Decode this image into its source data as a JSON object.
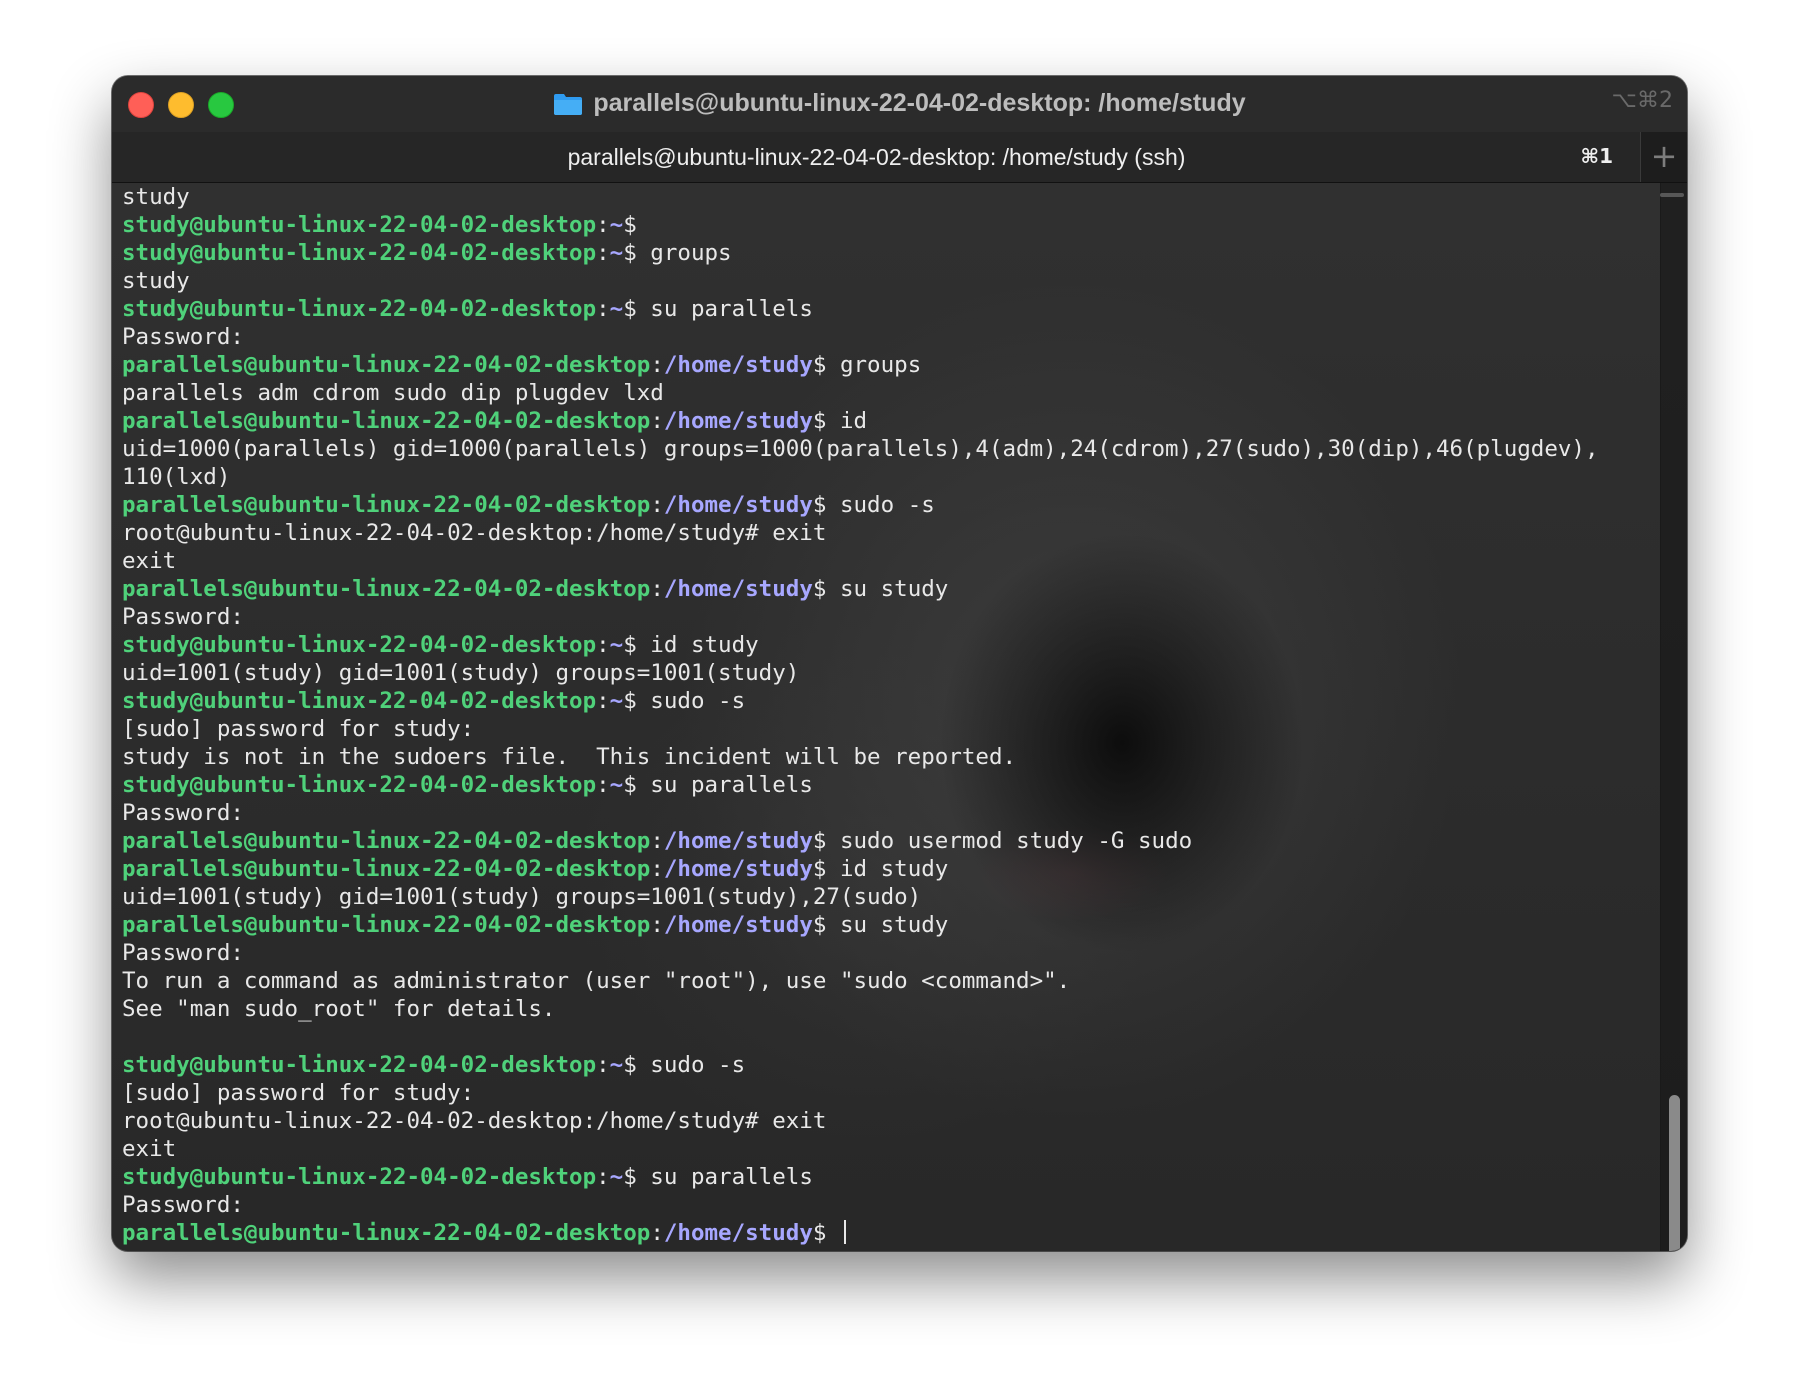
{
  "window": {
    "title": "parallels@ubuntu-linux-22-04-02-desktop: /home/study",
    "title_shortcut": "⌥⌘2",
    "folder_icon": "folder-icon"
  },
  "tab": {
    "label": "parallels@ubuntu-linux-22-04-02-desktop: /home/study (ssh)",
    "shortcut": "⌘1",
    "new_tab_label": "+"
  },
  "colors": {
    "prompt_user": "#4fd17a",
    "prompt_path": "#a7a7ff",
    "text": "#e8e8e8",
    "background": "#2c2c2c"
  },
  "terminal": {
    "lines": [
      {
        "text": "study"
      },
      {
        "user": "study@ubuntu-linux-22-04-02-desktop",
        "path": "~",
        "cmd": "$"
      },
      {
        "user": "study@ubuntu-linux-22-04-02-desktop",
        "path": "~",
        "cmd": "$ groups"
      },
      {
        "text": "study"
      },
      {
        "user": "study@ubuntu-linux-22-04-02-desktop",
        "path": "~",
        "cmd": "$ su parallels"
      },
      {
        "text": "Password:"
      },
      {
        "user": "parallels@ubuntu-linux-22-04-02-desktop",
        "path": "/home/study",
        "cmd": "$ groups"
      },
      {
        "text": "parallels adm cdrom sudo dip plugdev lxd"
      },
      {
        "user": "parallels@ubuntu-linux-22-04-02-desktop",
        "path": "/home/study",
        "cmd": "$ id"
      },
      {
        "text": "uid=1000(parallels) gid=1000(parallels) groups=1000(parallels),4(adm),24(cdrom),27(sudo),30(dip),46(plugdev),"
      },
      {
        "text": "110(lxd)"
      },
      {
        "user": "parallels@ubuntu-linux-22-04-02-desktop",
        "path": "/home/study",
        "cmd": "$ sudo -s"
      },
      {
        "text": "root@ubuntu-linux-22-04-02-desktop:/home/study# exit"
      },
      {
        "text": "exit"
      },
      {
        "user": "parallels@ubuntu-linux-22-04-02-desktop",
        "path": "/home/study",
        "cmd": "$ su study"
      },
      {
        "text": "Password:"
      },
      {
        "user": "study@ubuntu-linux-22-04-02-desktop",
        "path": "~",
        "cmd": "$ id study"
      },
      {
        "text": "uid=1001(study) gid=1001(study) groups=1001(study)"
      },
      {
        "user": "study@ubuntu-linux-22-04-02-desktop",
        "path": "~",
        "cmd": "$ sudo -s"
      },
      {
        "text": "[sudo] password for study:"
      },
      {
        "text": "study is not in the sudoers file.  This incident will be reported."
      },
      {
        "user": "study@ubuntu-linux-22-04-02-desktop",
        "path": "~",
        "cmd": "$ su parallels"
      },
      {
        "text": "Password:"
      },
      {
        "user": "parallels@ubuntu-linux-22-04-02-desktop",
        "path": "/home/study",
        "cmd": "$ sudo usermod study -G sudo"
      },
      {
        "user": "parallels@ubuntu-linux-22-04-02-desktop",
        "path": "/home/study",
        "cmd": "$ id study"
      },
      {
        "text": "uid=1001(study) gid=1001(study) groups=1001(study),27(sudo)"
      },
      {
        "user": "parallels@ubuntu-linux-22-04-02-desktop",
        "path": "/home/study",
        "cmd": "$ su study"
      },
      {
        "text": "Password:"
      },
      {
        "text": "To run a command as administrator (user \"root\"), use \"sudo <command>\"."
      },
      {
        "text": "See \"man sudo_root\" for details."
      },
      {
        "text": ""
      },
      {
        "user": "study@ubuntu-linux-22-04-02-desktop",
        "path": "~",
        "cmd": "$ sudo -s"
      },
      {
        "text": "[sudo] password for study:"
      },
      {
        "text": "root@ubuntu-linux-22-04-02-desktop:/home/study# exit"
      },
      {
        "text": "exit"
      },
      {
        "user": "study@ubuntu-linux-22-04-02-desktop",
        "path": "~",
        "cmd": "$ su parallels"
      },
      {
        "text": "Password:"
      },
      {
        "user": "parallels@ubuntu-linux-22-04-02-desktop",
        "path": "/home/study",
        "cmd": "$ ",
        "cursor": true
      }
    ]
  }
}
